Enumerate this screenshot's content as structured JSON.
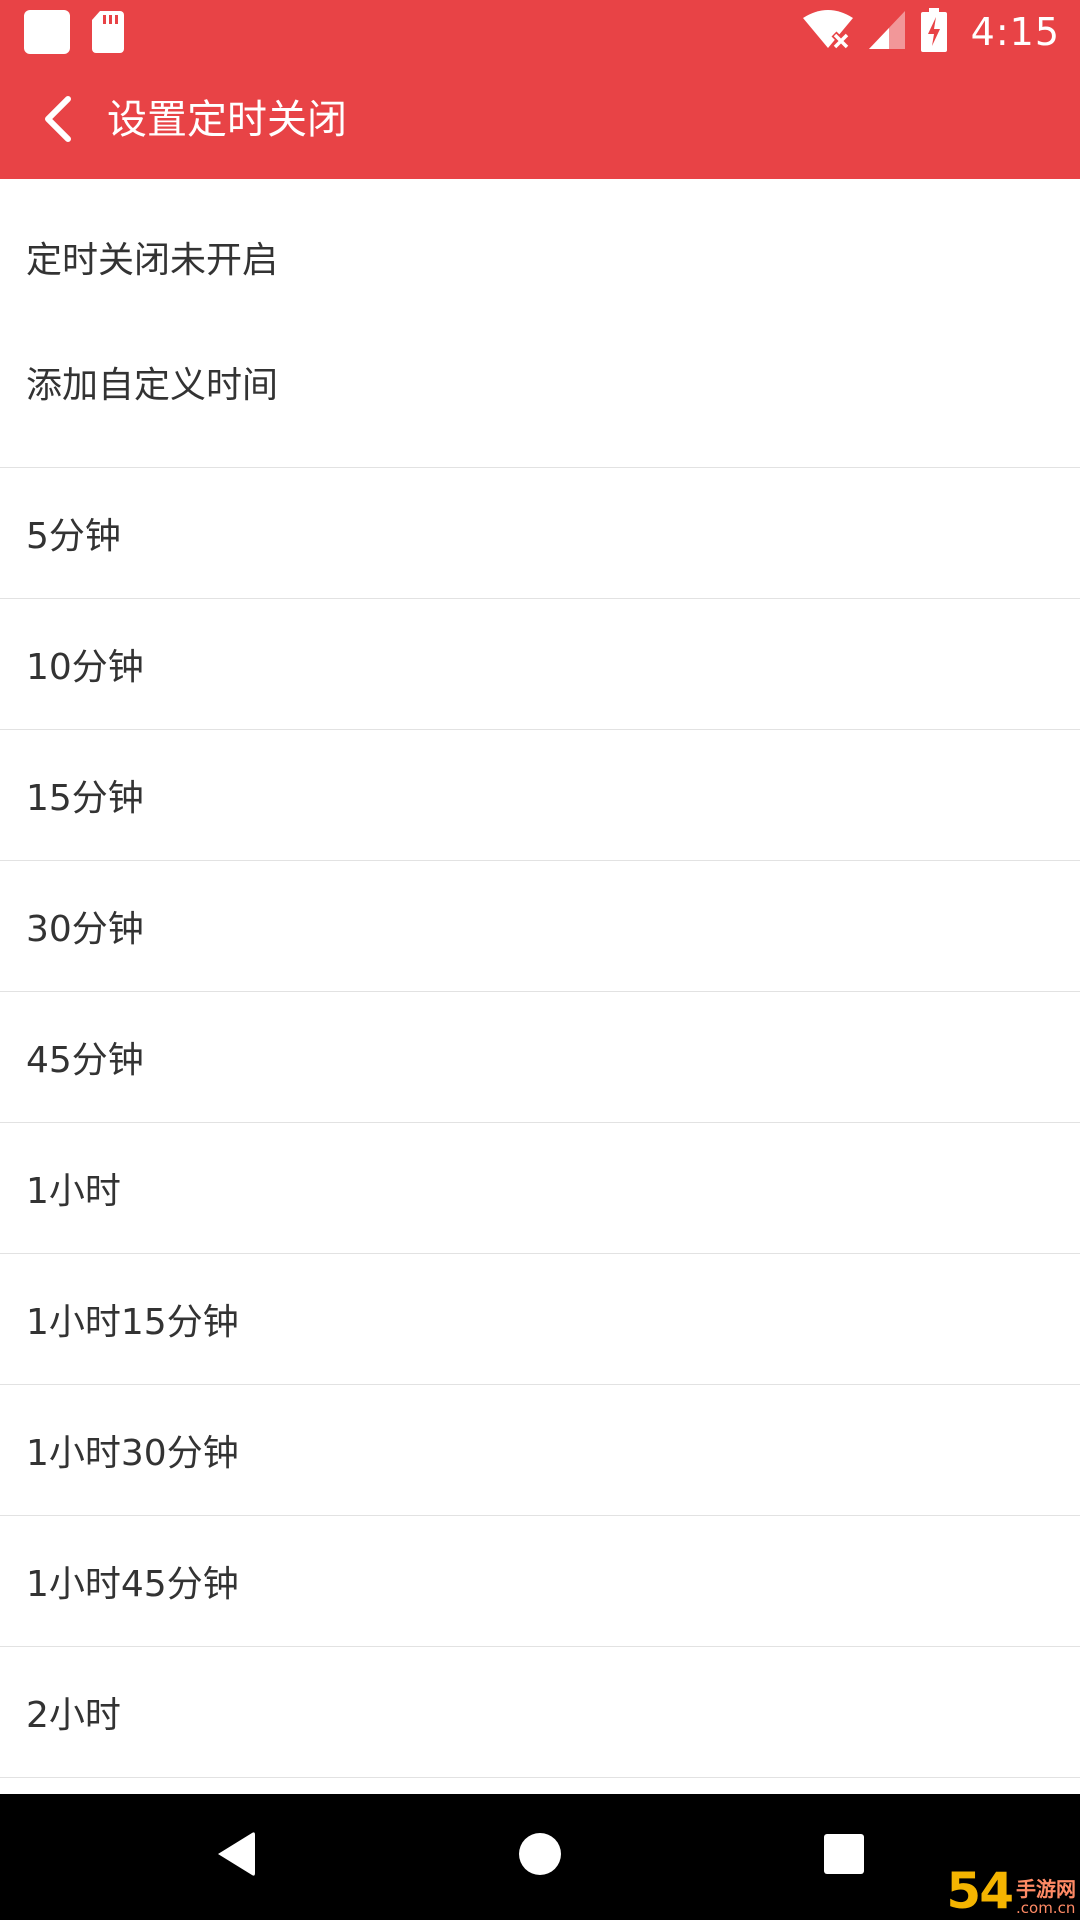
{
  "status_bar": {
    "time": "4:15",
    "icons": {
      "left": [
        "notification-square-icon",
        "sd-card-icon"
      ],
      "right": [
        "wifi-off-icon",
        "cellular-signal-icon",
        "battery-charging-icon"
      ]
    }
  },
  "app_bar": {
    "back_icon": "chevron-left-icon",
    "title": "设置定时关闭"
  },
  "list": {
    "items": [
      {
        "label": "定时关闭未开启"
      },
      {
        "label": "添加自定义时间"
      },
      {
        "label": "5分钟"
      },
      {
        "label": "10分钟"
      },
      {
        "label": "15分钟"
      },
      {
        "label": "30分钟"
      },
      {
        "label": "45分钟"
      },
      {
        "label": "1小时"
      },
      {
        "label": "1小时15分钟"
      },
      {
        "label": "1小时30分钟"
      },
      {
        "label": "1小时45分钟"
      },
      {
        "label": "2小时"
      }
    ]
  },
  "nav_bar": {
    "icons": [
      "triangle-back-icon",
      "circle-home-icon",
      "square-recents-icon"
    ]
  },
  "watermark": {
    "number": "54",
    "cn": "手游网",
    "url": ".com.cn"
  },
  "colors": {
    "primary": "#e84346",
    "text": "#333333",
    "divider": "#e2e2e2",
    "navbar": "#000000"
  }
}
